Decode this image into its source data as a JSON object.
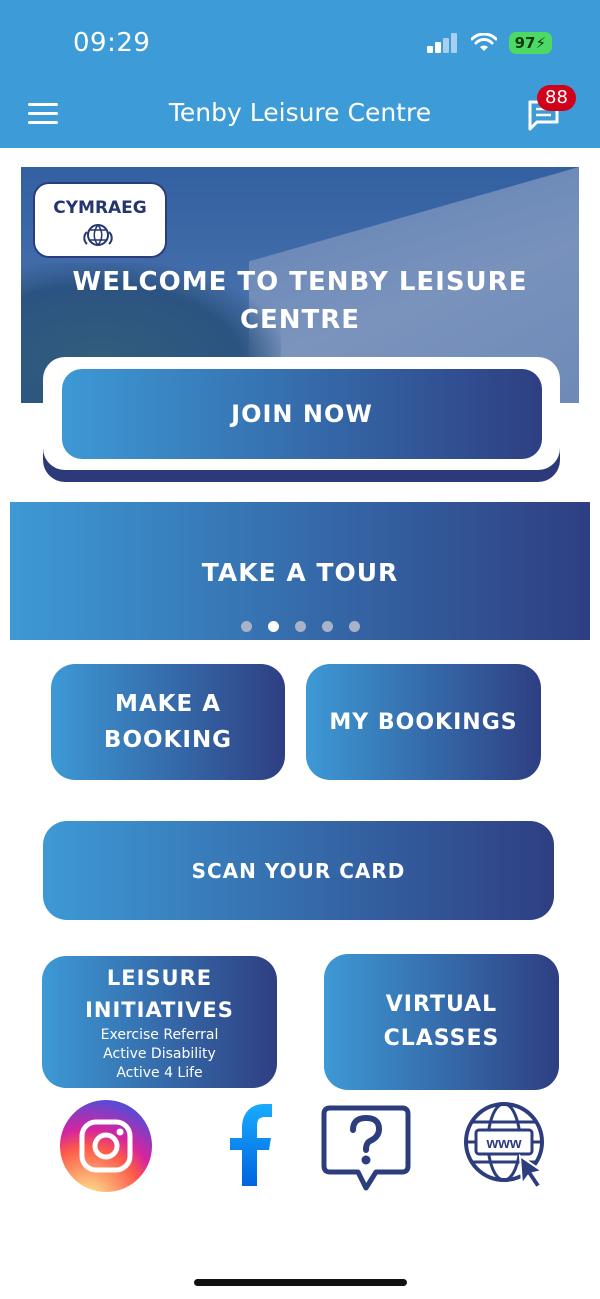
{
  "status_bar": {
    "time": "09:29",
    "battery": "97"
  },
  "header": {
    "title": "Tenby Leisure Centre",
    "message_count": "88"
  },
  "hero": {
    "language_button": "CYMRAEG",
    "welcome_line1": "WELCOME TO TENBY LEISURE",
    "welcome_line2": "CENTRE"
  },
  "join_button": "JOIN NOW",
  "tour": {
    "label": "TAKE A TOUR",
    "slide_count": 5,
    "active_slide": 2
  },
  "buttons": {
    "make_booking_line1": "MAKE A",
    "make_booking_line2": "BOOKING",
    "my_bookings": "MY BOOKINGS",
    "scan_card": "SCAN YOUR CARD",
    "leisure_line1": "LEISURE",
    "leisure_line2": "INITIATIVES",
    "leisure_items": [
      "Exercise Referral",
      "Active Disability",
      "Active 4 Life"
    ],
    "virtual_line1": "VIRTUAL",
    "virtual_line2": "CLASSES"
  },
  "social": {
    "web_label": "www"
  },
  "colors": {
    "header": "#3d9bd7",
    "gradient_start": "#3d99d5",
    "gradient_end": "#2e3f82",
    "badge": "#d0021b",
    "navy": "#2b3d7c"
  }
}
